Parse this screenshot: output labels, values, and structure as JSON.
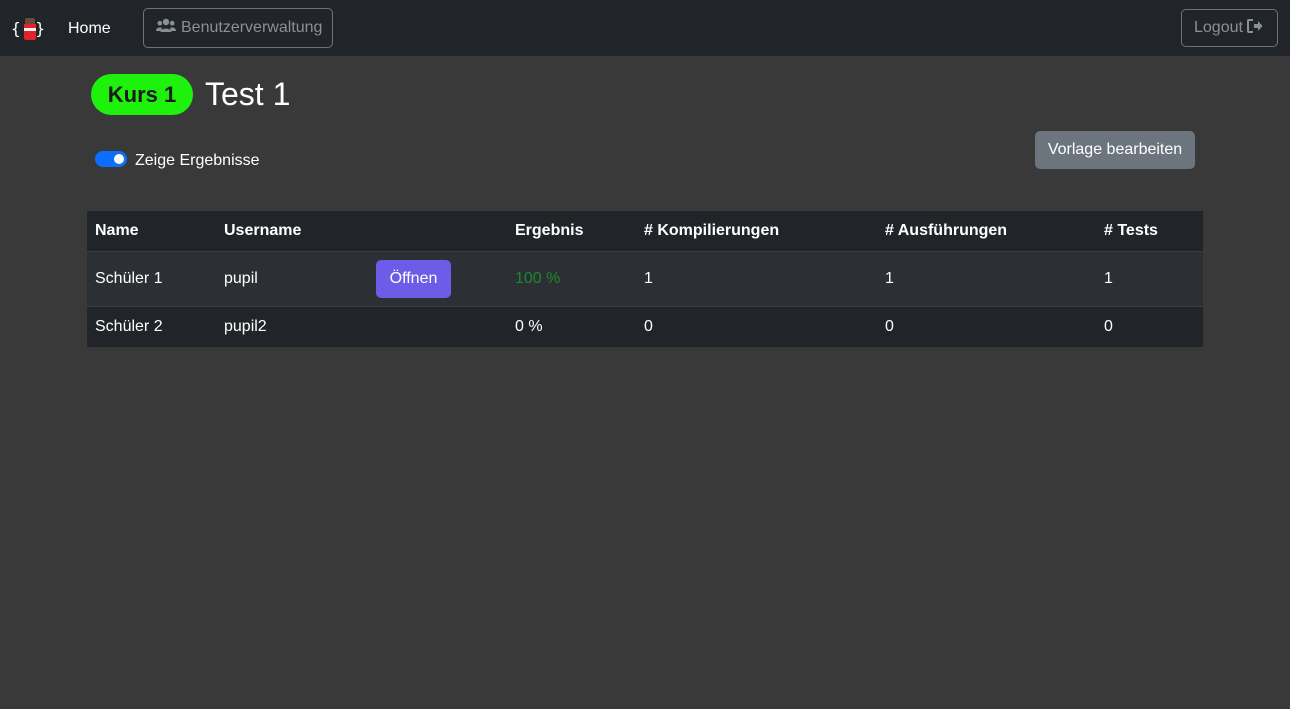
{
  "nav": {
    "home_label": "Home",
    "users_label": "Benutzerverwaltung",
    "users_icon": "users-icon",
    "logout_label": "Logout",
    "logout_icon": "sign-out-icon"
  },
  "header": {
    "course_badge": "Kurs 1",
    "title": "Test 1",
    "badge_color": "#1ef20c"
  },
  "controls": {
    "toggle_label": "Zeige Ergebnisse",
    "toggle_on": true,
    "template_button": "Vorlage bearbeiten"
  },
  "table": {
    "columns": [
      "Name",
      "Username",
      "",
      "Ergebnis",
      "# Kompilierungen",
      "# Ausführungen",
      "# Tests"
    ],
    "rows": [
      {
        "name": "Schüler 1",
        "username": "pupil",
        "action": "Öffnen",
        "result": "100 %",
        "compilations": "1",
        "executions": "1",
        "tests": "1"
      },
      {
        "name": "Schüler 2",
        "username": "pupil2",
        "action": "",
        "result": "0 %",
        "compilations": "0",
        "executions": "0",
        "tests": "0"
      }
    ]
  },
  "colors": {
    "accent": "#0d6efd",
    "open_button": "#6c5ce7",
    "success_text": "#198a2b"
  }
}
